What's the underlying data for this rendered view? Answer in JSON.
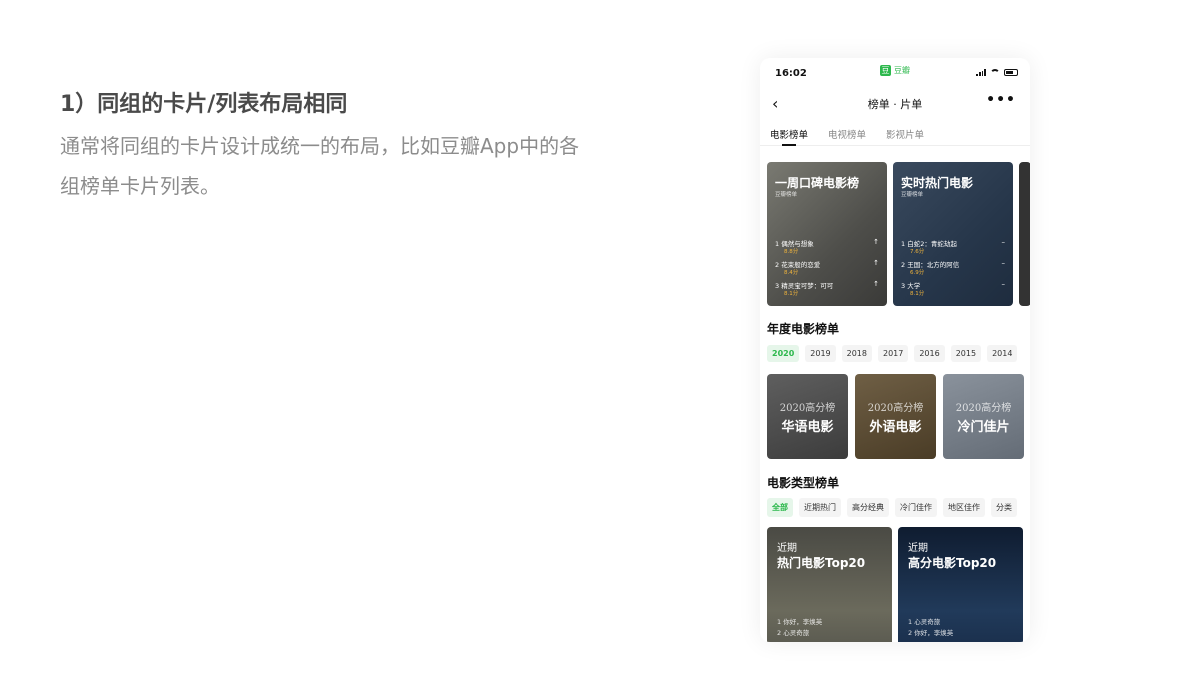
{
  "intro": {
    "title": "1）同组的卡片/列表布局相同",
    "description": "通常将同组的卡片设计成统一的布局，比如豆瓣App中的各组榜单卡片列表。"
  },
  "status_bar": {
    "time": "16:02",
    "app_name": "豆瓣",
    "app_logo": "豆"
  },
  "navbar": {
    "back_icon": "‹",
    "title": "榜单 · 片单",
    "more_icon": "•••"
  },
  "tabs": [
    {
      "label": "电影榜单",
      "active": true
    },
    {
      "label": "电视榜单",
      "active": false
    },
    {
      "label": "影视片单",
      "active": false
    }
  ],
  "rank_cards": [
    {
      "title": "一周口碑电影榜",
      "subtitle": "豆瓣榜单",
      "items": [
        {
          "name": "1  偶然与想象",
          "score": "8.8分",
          "trend": "↑"
        },
        {
          "name": "2  花束般的恋爱",
          "score": "8.4分",
          "trend": "↑"
        },
        {
          "name": "3  精灵宝可梦：可可",
          "score": "8.1分",
          "trend": "↑"
        }
      ]
    },
    {
      "title": "实时热门电影",
      "subtitle": "豆瓣榜单",
      "items": [
        {
          "name": "1  白蛇2：青蛇劫起",
          "score": "7.6分",
          "trend": "–"
        },
        {
          "name": "2  王国：北方的阿信",
          "score": "6.9分",
          "trend": "–"
        },
        {
          "name": "3  大学",
          "score": "8.1分",
          "trend": "–"
        }
      ]
    }
  ],
  "annual": {
    "title": "年度电影榜单",
    "years": [
      {
        "label": "2020",
        "active": true
      },
      {
        "label": "2019",
        "active": false
      },
      {
        "label": "2018",
        "active": false
      },
      {
        "label": "2017",
        "active": false
      },
      {
        "label": "2016",
        "active": false
      },
      {
        "label": "2015",
        "active": false
      },
      {
        "label": "2014",
        "active": false
      }
    ],
    "cards": [
      {
        "top": "2020高分榜",
        "main": "华语电影"
      },
      {
        "top": "2020高分榜",
        "main": "外语电影"
      },
      {
        "top": "2020高分榜",
        "main": "冷门佳片"
      }
    ]
  },
  "genre": {
    "title": "电影类型榜单",
    "chips": [
      {
        "label": "全部",
        "active": true
      },
      {
        "label": "近期热门",
        "active": false
      },
      {
        "label": "高分经典",
        "active": false
      },
      {
        "label": "冷门佳作",
        "active": false
      },
      {
        "label": "地区佳作",
        "active": false
      },
      {
        "label": "分类",
        "active": false
      }
    ],
    "cards": [
      {
        "pre": "近期",
        "title": "热门电影Top20",
        "items": [
          "1  你好，李焕英",
          "2  心灵奇旅"
        ]
      },
      {
        "pre": "近期",
        "title": "高分电影Top20",
        "items": [
          "1  心灵奇旅",
          "2  你好，李焕英"
        ]
      }
    ]
  },
  "colors": {
    "accent_green": "#2db84d",
    "score_orange": "#f0b43c"
  }
}
